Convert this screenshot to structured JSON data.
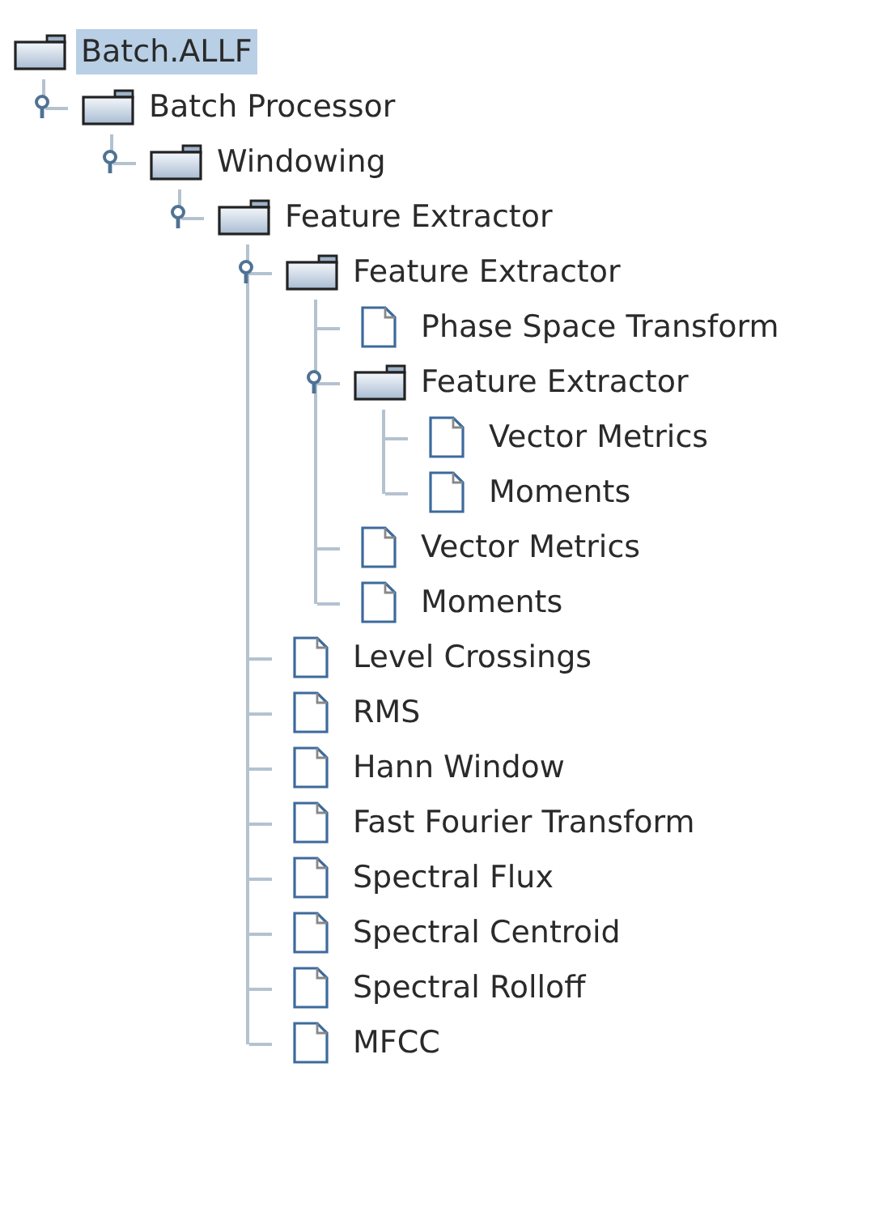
{
  "tree": {
    "label": "Batch.ALLF",
    "kind": "folder",
    "selected": true,
    "children": [
      {
        "label": "Batch Processor",
        "kind": "folder",
        "selected": false,
        "expanded": true,
        "children": [
          {
            "label": "Windowing",
            "kind": "folder",
            "selected": false,
            "expanded": true,
            "children": [
              {
                "label": "Feature Extractor",
                "kind": "folder",
                "selected": false,
                "expanded": true,
                "children": [
                  {
                    "label": "Feature Extractor",
                    "kind": "folder",
                    "selected": false,
                    "expanded": true,
                    "children": [
                      {
                        "label": "Phase Space Transform",
                        "kind": "leaf",
                        "selected": false
                      },
                      {
                        "label": "Feature Extractor",
                        "kind": "folder",
                        "selected": false,
                        "expanded": true,
                        "children": [
                          {
                            "label": "Vector Metrics",
                            "kind": "leaf",
                            "selected": false
                          },
                          {
                            "label": "Moments",
                            "kind": "leaf",
                            "selected": false
                          }
                        ]
                      },
                      {
                        "label": "Vector Metrics",
                        "kind": "leaf",
                        "selected": false
                      },
                      {
                        "label": "Moments",
                        "kind": "leaf",
                        "selected": false
                      }
                    ]
                  },
                  {
                    "label": "Level Crossings",
                    "kind": "leaf",
                    "selected": false
                  },
                  {
                    "label": "RMS",
                    "kind": "leaf",
                    "selected": false
                  },
                  {
                    "label": "Hann Window",
                    "kind": "leaf",
                    "selected": false
                  },
                  {
                    "label": "Fast Fourier Transform",
                    "kind": "leaf",
                    "selected": false
                  },
                  {
                    "label": "Spectral Flux",
                    "kind": "leaf",
                    "selected": false
                  },
                  {
                    "label": "Spectral Centroid",
                    "kind": "leaf",
                    "selected": false
                  },
                  {
                    "label": "Spectral Rolloff",
                    "kind": "leaf",
                    "selected": false
                  },
                  {
                    "label": "MFCC",
                    "kind": "leaf",
                    "selected": false
                  }
                ]
              }
            ]
          }
        ]
      }
    ]
  }
}
